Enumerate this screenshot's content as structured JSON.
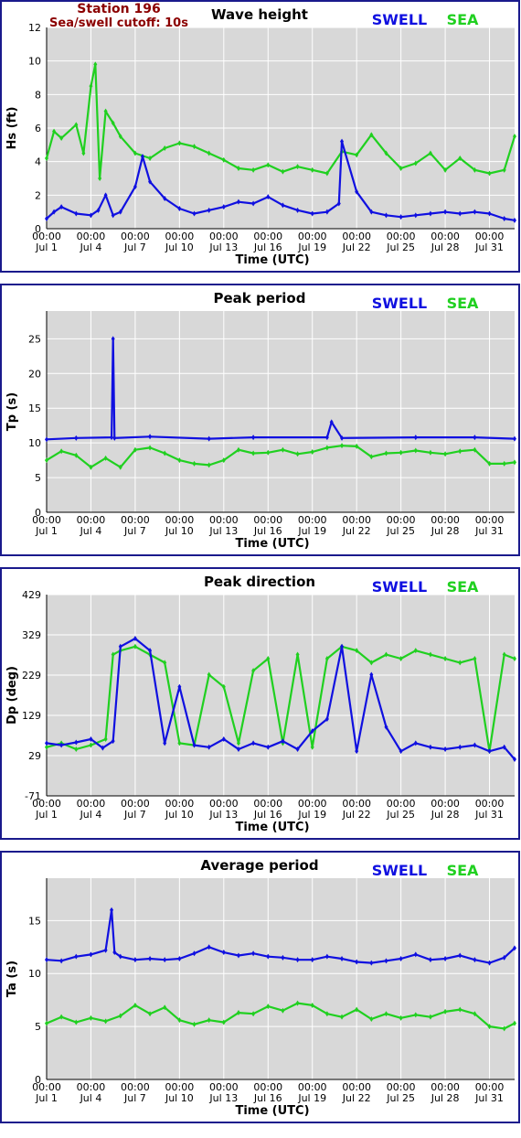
{
  "header": {
    "station": "Station 196",
    "cutoff": "Sea/swell cutoff: 10s"
  },
  "legend": {
    "swell": "SWELL",
    "sea": "SEA"
  },
  "colors": {
    "swell": "#1010e0",
    "sea": "#20d020",
    "frame": "#1a1a8c",
    "plot_bg": "#d8d8d8",
    "grid": "#ffffff",
    "header_red": "#8b0000"
  },
  "x_axis": {
    "label": "Time (UTC)",
    "ticks": [
      {
        "top": "00:00",
        "bottom": "Jul 1"
      },
      {
        "top": "00:00",
        "bottom": "Jul 4"
      },
      {
        "top": "00:00",
        "bottom": "Jul 7"
      },
      {
        "top": "00:00",
        "bottom": "Jul 10"
      },
      {
        "top": "00:00",
        "bottom": "Jul 13"
      },
      {
        "top": "00:00",
        "bottom": "Jul 16"
      },
      {
        "top": "00:00",
        "bottom": "Jul 19"
      },
      {
        "top": "00:00",
        "bottom": "Jul 22"
      },
      {
        "top": "00:00",
        "bottom": "Jul 25"
      },
      {
        "top": "00:00",
        "bottom": "Jul 28"
      },
      {
        "top": "00:00",
        "bottom": "Jul 31"
      }
    ],
    "tick_days": [
      1,
      4,
      7,
      10,
      13,
      16,
      19,
      22,
      25,
      28,
      31
    ],
    "range_days": [
      1,
      32.7
    ]
  },
  "chart_data": [
    {
      "type": "line",
      "title": "Wave height",
      "ylabel": "Hs (ft)",
      "ylim": [
        0,
        12
      ],
      "yticks": [
        0,
        2,
        4,
        6,
        8,
        10,
        12
      ],
      "grid": true,
      "legend_position": "top-right",
      "series": [
        {
          "name": "SWELL",
          "x": [
            "Jul 1",
            "Jul 1.5",
            "Jul 2",
            "Jul 3",
            "Jul 4",
            "Jul 4.5",
            "Jul 5",
            "Jul 5.5",
            "Jul 6",
            "Jul 7",
            "Jul 7.5",
            "Jul 8",
            "Jul 9",
            "Jul 10",
            "Jul 11",
            "Jul 12",
            "Jul 13",
            "Jul 14",
            "Jul 15",
            "Jul 16",
            "Jul 17",
            "Jul 18",
            "Jul 19",
            "Jul 20",
            "Jul 20.8",
            "Jul 21",
            "Jul 22",
            "Jul 23",
            "Jul 24",
            "Jul 25",
            "Jul 26",
            "Jul 27",
            "Jul 28",
            "Jul 29",
            "Jul 30",
            "Jul 31",
            "Jul 32",
            "Jul 32.7"
          ],
          "values": [
            0.6,
            1.0,
            1.3,
            0.9,
            0.8,
            1.1,
            2.0,
            0.8,
            1.0,
            2.5,
            4.3,
            2.8,
            1.8,
            1.2,
            0.9,
            1.1,
            1.3,
            1.6,
            1.5,
            1.9,
            1.4,
            1.1,
            0.9,
            1.0,
            1.5,
            5.2,
            2.2,
            1.0,
            0.8,
            0.7,
            0.8,
            0.9,
            1.0,
            0.9,
            1.0,
            0.9,
            0.6,
            0.5
          ]
        },
        {
          "name": "SEA",
          "x": [
            "Jul 1",
            "Jul 1.5",
            "Jul 2",
            "Jul 3",
            "Jul 3.5",
            "Jul 4",
            "Jul 4.3",
            "Jul 4.6",
            "Jul 5",
            "Jul 5.5",
            "Jul 6",
            "Jul 7",
            "Jul 8",
            "Jul 9",
            "Jul 10",
            "Jul 11",
            "Jul 12",
            "Jul 13",
            "Jul 14",
            "Jul 15",
            "Jul 16",
            "Jul 17",
            "Jul 18",
            "Jul 19",
            "Jul 20",
            "Jul 21",
            "Jul 22",
            "Jul 23",
            "Jul 24",
            "Jul 25",
            "Jul 26",
            "Jul 27",
            "Jul 28",
            "Jul 29",
            "Jul 30",
            "Jul 31",
            "Jul 32",
            "Jul 32.7"
          ],
          "values": [
            4.2,
            5.8,
            5.4,
            6.2,
            4.5,
            8.5,
            9.8,
            3.0,
            7.0,
            6.3,
            5.5,
            4.5,
            4.2,
            4.8,
            5.1,
            4.9,
            4.5,
            4.1,
            3.6,
            3.5,
            3.8,
            3.4,
            3.7,
            3.5,
            3.3,
            4.6,
            4.4,
            5.6,
            4.5,
            3.6,
            3.9,
            4.5,
            3.5,
            4.2,
            3.5,
            3.3,
            3.5,
            5.5
          ]
        }
      ]
    },
    {
      "type": "line",
      "title": "Peak period",
      "ylabel": "Tp (s)",
      "ylim": [
        0,
        29
      ],
      "yticks": [
        0,
        5,
        10,
        15,
        20,
        25
      ],
      "grid": true,
      "legend_position": "top-right",
      "series": [
        {
          "name": "SWELL",
          "x": [
            "Jul 1",
            "Jul 3",
            "Jul 5.4",
            "Jul 5.5",
            "Jul 5.6",
            "Jul 8",
            "Jul 12",
            "Jul 15",
            "Jul 20",
            "Jul 20.3",
            "Jul 21",
            "Jul 26",
            "Jul 30",
            "Jul 32.7"
          ],
          "values": [
            10.5,
            10.7,
            10.8,
            25.0,
            10.7,
            10.9,
            10.6,
            10.8,
            10.8,
            13.0,
            10.7,
            10.8,
            10.8,
            10.6
          ]
        },
        {
          "name": "SEA",
          "x": [
            "Jul 1",
            "Jul 2",
            "Jul 3",
            "Jul 4",
            "Jul 5",
            "Jul 6",
            "Jul 7",
            "Jul 8",
            "Jul 9",
            "Jul 10",
            "Jul 11",
            "Jul 12",
            "Jul 13",
            "Jul 14",
            "Jul 15",
            "Jul 16",
            "Jul 17",
            "Jul 18",
            "Jul 19",
            "Jul 20",
            "Jul 21",
            "Jul 22",
            "Jul 23",
            "Jul 24",
            "Jul 25",
            "Jul 26",
            "Jul 27",
            "Jul 28",
            "Jul 29",
            "Jul 30",
            "Jul 31",
            "Jul 32",
            "Jul 32.7"
          ],
          "values": [
            7.5,
            8.8,
            8.2,
            6.5,
            7.8,
            6.5,
            9.0,
            9.3,
            8.5,
            7.5,
            7.0,
            6.8,
            7.5,
            9.0,
            8.5,
            8.6,
            9.0,
            8.4,
            8.7,
            9.3,
            9.6,
            9.5,
            8.0,
            8.5,
            8.6,
            8.9,
            8.6,
            8.4,
            8.8,
            9.0,
            7.0,
            7.0,
            7.2
          ]
        }
      ]
    },
    {
      "type": "line",
      "title": "Peak direction",
      "ylabel": "Dp (deg)",
      "ylim": [
        -71,
        429
      ],
      "yticks": [
        -71,
        29,
        129,
        229,
        329,
        429
      ],
      "grid": true,
      "legend_position": "top-right",
      "series": [
        {
          "name": "SWELL",
          "x": [
            "Jul 1",
            "Jul 2",
            "Jul 3",
            "Jul 4",
            "Jul 4.8",
            "Jul 5.5",
            "Jul 6",
            "Jul 7",
            "Jul 8",
            "Jul 9",
            "Jul 10",
            "Jul 11",
            "Jul 12",
            "Jul 13",
            "Jul 14",
            "Jul 15",
            "Jul 16",
            "Jul 17",
            "Jul 18",
            "Jul 19",
            "Jul 20",
            "Jul 21",
            "Jul 22",
            "Jul 23",
            "Jul 24",
            "Jul 25",
            "Jul 26",
            "Jul 27",
            "Jul 28",
            "Jul 29",
            "Jul 30",
            "Jul 31",
            "Jul 32",
            "Jul 32.7"
          ],
          "values": [
            60,
            55,
            62,
            70,
            48,
            65,
            300,
            320,
            290,
            60,
            200,
            55,
            50,
            70,
            45,
            60,
            50,
            65,
            45,
            90,
            120,
            300,
            40,
            230,
            100,
            40,
            60,
            50,
            45,
            50,
            55,
            40,
            50,
            20
          ]
        },
        {
          "name": "SEA",
          "x": [
            "Jul 1",
            "Jul 2",
            "Jul 3",
            "Jul 4",
            "Jul 5",
            "Jul 5.5",
            "Jul 6",
            "Jul 7",
            "Jul 8",
            "Jul 9",
            "Jul 10",
            "Jul 11",
            "Jul 12",
            "Jul 13",
            "Jul 14",
            "Jul 15",
            "Jul 16",
            "Jul 17",
            "Jul 18",
            "Jul 19",
            "Jul 20",
            "Jul 21",
            "Jul 22",
            "Jul 23",
            "Jul 24",
            "Jul 25",
            "Jul 26",
            "Jul 27",
            "Jul 28",
            "Jul 29",
            "Jul 30",
            "Jul 31",
            "Jul 32",
            "Jul 32.7"
          ],
          "values": [
            50,
            60,
            45,
            55,
            70,
            280,
            290,
            300,
            280,
            260,
            60,
            55,
            230,
            200,
            60,
            240,
            270,
            60,
            280,
            50,
            270,
            300,
            290,
            260,
            280,
            270,
            290,
            280,
            270,
            260,
            270,
            40,
            280,
            270
          ]
        }
      ]
    },
    {
      "type": "line",
      "title": "Average period",
      "ylabel": "Ta (s)",
      "ylim": [
        0,
        19
      ],
      "yticks": [
        0,
        5,
        10,
        15
      ],
      "grid": true,
      "legend_position": "top-right",
      "series": [
        {
          "name": "SWELL",
          "x": [
            "Jul 1",
            "Jul 2",
            "Jul 3",
            "Jul 4",
            "Jul 5",
            "Jul 5.4",
            "Jul 5.6",
            "Jul 6",
            "Jul 7",
            "Jul 8",
            "Jul 9",
            "Jul 10",
            "Jul 11",
            "Jul 12",
            "Jul 13",
            "Jul 14",
            "Jul 15",
            "Jul 16",
            "Jul 17",
            "Jul 18",
            "Jul 19",
            "Jul 20",
            "Jul 21",
            "Jul 22",
            "Jul 23",
            "Jul 24",
            "Jul 25",
            "Jul 26",
            "Jul 27",
            "Jul 28",
            "Jul 29",
            "Jul 30",
            "Jul 31",
            "Jul 32",
            "Jul 32.7"
          ],
          "values": [
            11.3,
            11.2,
            11.6,
            11.8,
            12.2,
            16.0,
            12.0,
            11.6,
            11.3,
            11.4,
            11.3,
            11.4,
            11.9,
            12.5,
            12.0,
            11.7,
            11.9,
            11.6,
            11.5,
            11.3,
            11.3,
            11.6,
            11.4,
            11.1,
            11.0,
            11.2,
            11.4,
            11.8,
            11.3,
            11.4,
            11.7,
            11.3,
            11.0,
            11.5,
            12.4
          ]
        },
        {
          "name": "SEA",
          "x": [
            "Jul 1",
            "Jul 2",
            "Jul 3",
            "Jul 4",
            "Jul 5",
            "Jul 6",
            "Jul 7",
            "Jul 8",
            "Jul 9",
            "Jul 10",
            "Jul 11",
            "Jul 12",
            "Jul 13",
            "Jul 14",
            "Jul 15",
            "Jul 16",
            "Jul 17",
            "Jul 18",
            "Jul 19",
            "Jul 20",
            "Jul 21",
            "Jul 22",
            "Jul 23",
            "Jul 24",
            "Jul 25",
            "Jul 26",
            "Jul 27",
            "Jul 28",
            "Jul 29",
            "Jul 30",
            "Jul 31",
            "Jul 32",
            "Jul 32.7"
          ],
          "values": [
            5.3,
            5.9,
            5.4,
            5.8,
            5.5,
            6.0,
            7.0,
            6.2,
            6.8,
            5.6,
            5.2,
            5.6,
            5.4,
            6.3,
            6.2,
            6.9,
            6.5,
            7.2,
            7.0,
            6.2,
            5.9,
            6.6,
            5.7,
            6.2,
            5.8,
            6.1,
            5.9,
            6.4,
            6.6,
            6.2,
            5.0,
            4.8,
            5.3
          ]
        }
      ]
    }
  ]
}
